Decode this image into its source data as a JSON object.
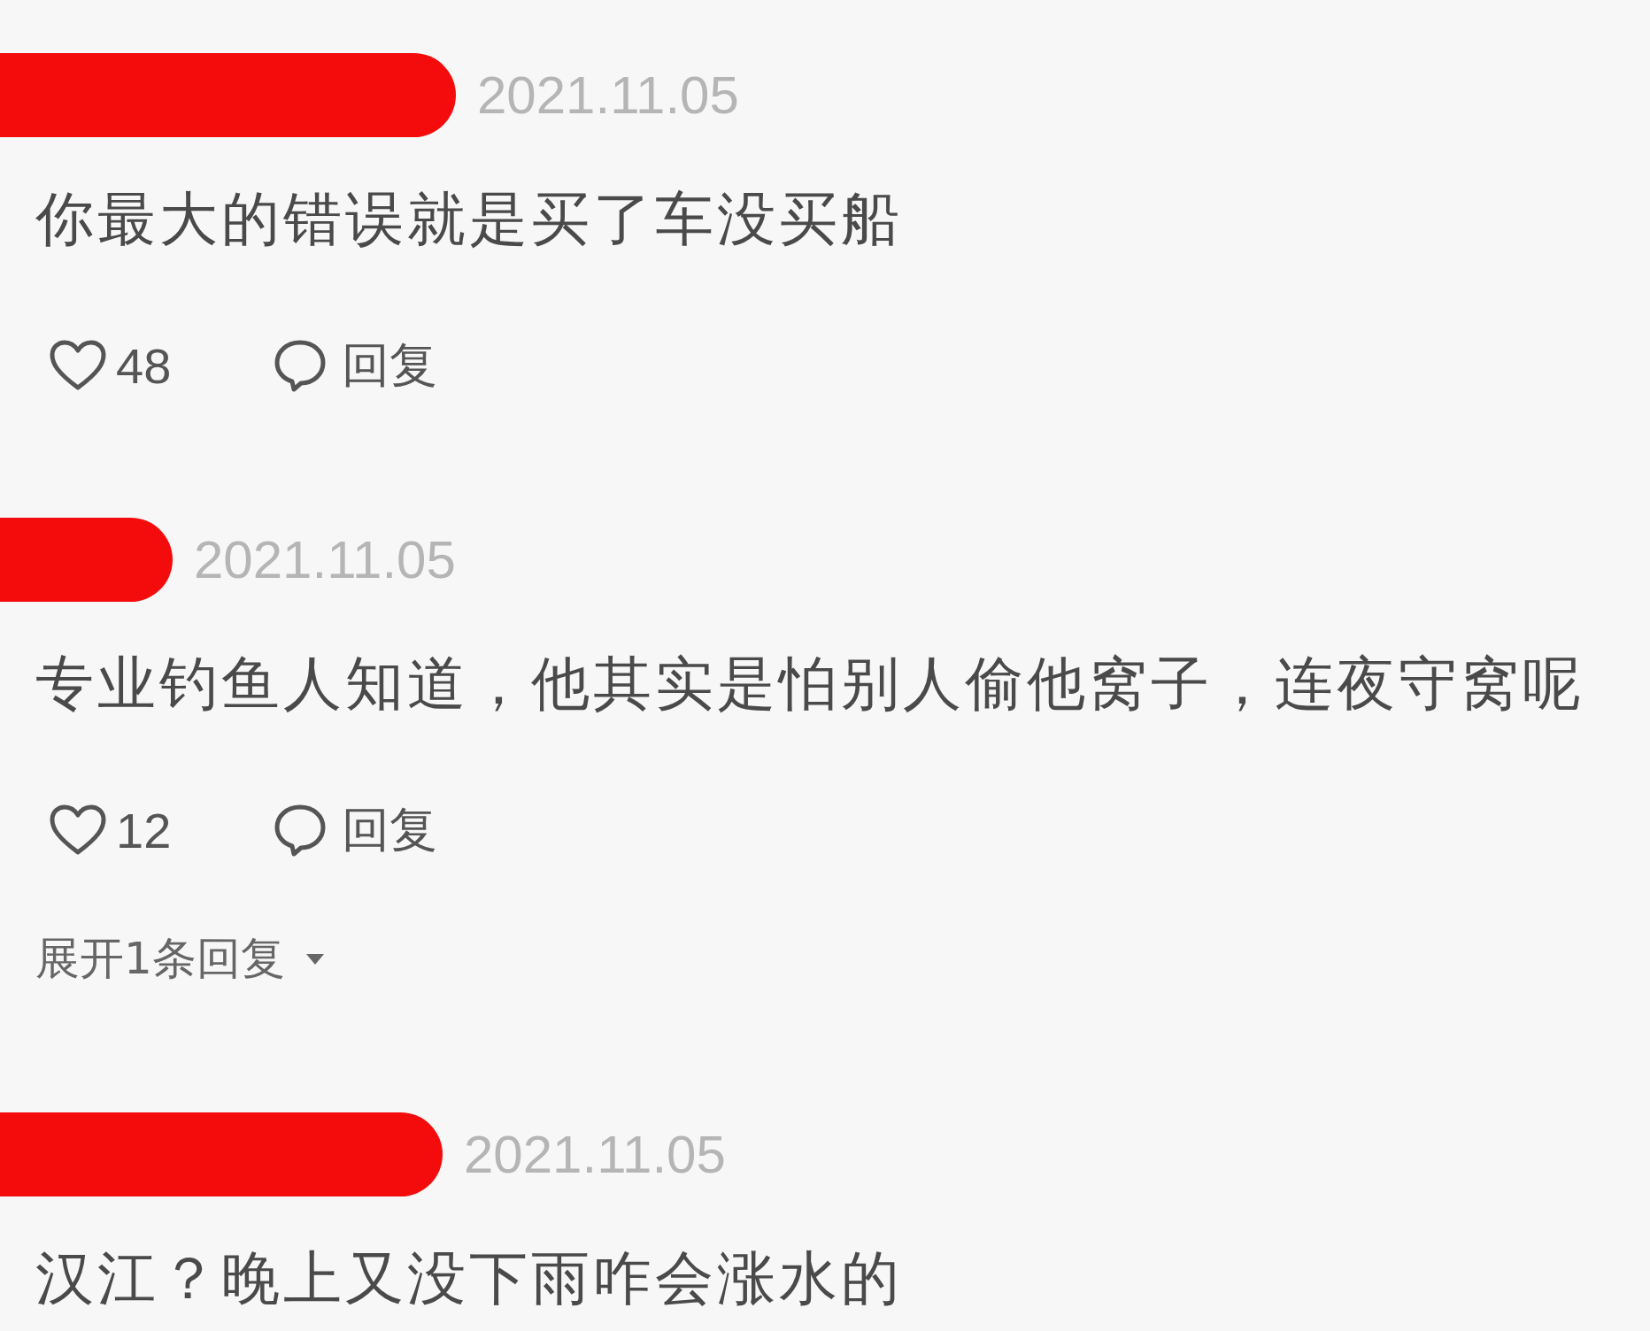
{
  "comments": [
    {
      "author_redacted": true,
      "date": "2021.11.05",
      "text": "你最大的错误就是买了车没买船",
      "likes": "48",
      "reply_label": "回复"
    },
    {
      "author_redacted": true,
      "date": "2021.11.05",
      "text": "专业钓鱼人知道，他其实是怕别人偷他窝子，连夜守窝呢",
      "likes": "12",
      "reply_label": "回复",
      "expand_replies": "展开1条回复"
    },
    {
      "author_redacted": true,
      "date": "2021.11.05",
      "text": "汉江？晚上又没下雨咋会涨水的"
    }
  ]
}
